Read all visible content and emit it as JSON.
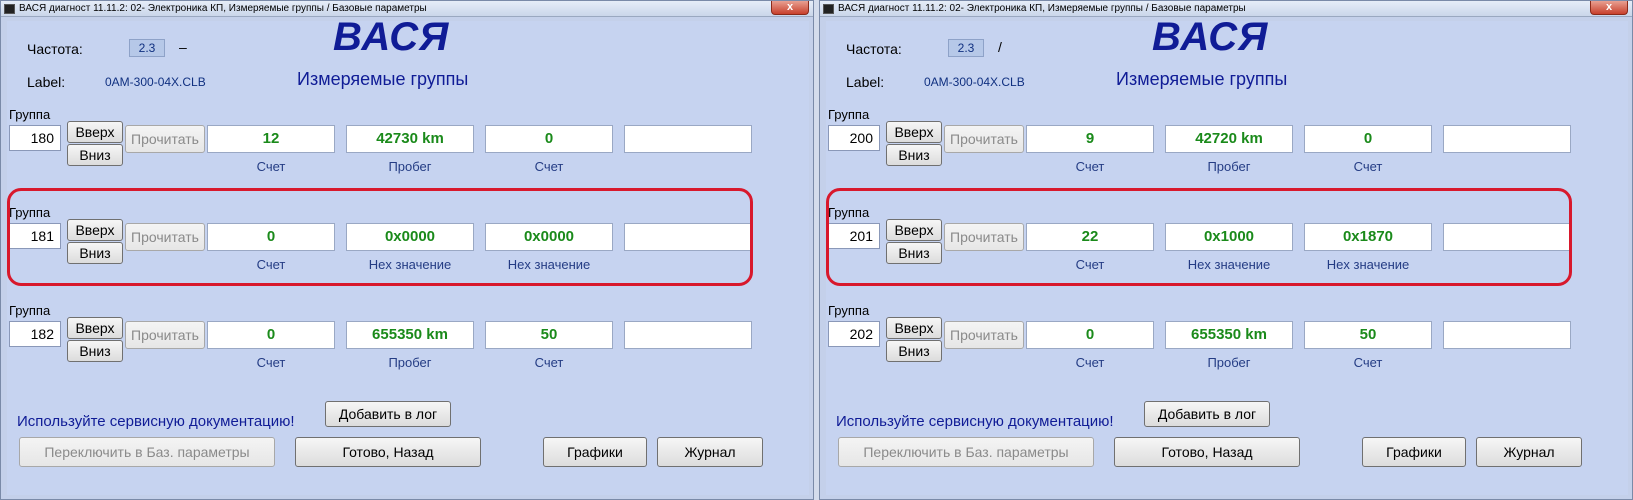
{
  "windows": [
    {
      "title": "ВАСЯ диагност 11.11.2: 02- Электроника КП,  Измеряемые группы / Базовые параметры",
      "close": "x",
      "freq_label": "Частота:",
      "freq_value": "2.3",
      "freq_indicator": "–",
      "brand": "ВАСЯ",
      "subtitle": "Измеряемые группы",
      "label_label": "Label:",
      "label_value": "0AM-300-04X.CLB",
      "groups": [
        {
          "group_label": "Группа",
          "number": "180",
          "up": "Вверх",
          "down": "Вниз",
          "read": "Прочитать",
          "values": [
            "12",
            "42730 km",
            "0",
            ""
          ],
          "units": [
            "Счет",
            "Пробег",
            "Счет",
            ""
          ]
        },
        {
          "group_label": "Группа",
          "number": "181",
          "up": "Вверх",
          "down": "Вниз",
          "read": "Прочитать",
          "values": [
            "0",
            "0x0000",
            "0x0000",
            ""
          ],
          "units": [
            "Счет",
            "Hex значение",
            "Hex значение",
            ""
          ]
        },
        {
          "group_label": "Группа",
          "number": "182",
          "up": "Вверх",
          "down": "Вниз",
          "read": "Прочитать",
          "values": [
            "0",
            "655350 km",
            "50",
            ""
          ],
          "units": [
            "Счет",
            "Пробег",
            "Счет",
            ""
          ]
        }
      ],
      "warning": "Используйте сервисную документацию!",
      "add_log": "Добавить в лог",
      "switch_basic": "Переключить в Баз. параметры",
      "done_back": "Готово, Назад",
      "graphs": "Графики",
      "journal": "Журнал"
    },
    {
      "title": "ВАСЯ диагност 11.11.2: 02- Электроника КП,  Измеряемые группы / Базовые параметры",
      "close": "x",
      "freq_label": "Частота:",
      "freq_value": "2.3",
      "freq_indicator": "/",
      "brand": "ВАСЯ",
      "subtitle": "Измеряемые группы",
      "label_label": "Label:",
      "label_value": "0AM-300-04X.CLB",
      "groups": [
        {
          "group_label": "Группа",
          "number": "200",
          "up": "Вверх",
          "down": "Вниз",
          "read": "Прочитать",
          "values": [
            "9",
            "42720 km",
            "0",
            ""
          ],
          "units": [
            "Счет",
            "Пробег",
            "Счет",
            ""
          ]
        },
        {
          "group_label": "Группа",
          "number": "201",
          "up": "Вверх",
          "down": "Вниз",
          "read": "Прочитать",
          "values": [
            "22",
            "0x1000",
            "0x1870",
            ""
          ],
          "units": [
            "Счет",
            "Hex значение",
            "Hex значение",
            ""
          ]
        },
        {
          "group_label": "Группа",
          "number": "202",
          "up": "Вверх",
          "down": "Вниз",
          "read": "Прочитать",
          "values": [
            "0",
            "655350 km",
            "50",
            ""
          ],
          "units": [
            "Счет",
            "Пробег",
            "Счет",
            ""
          ]
        }
      ],
      "warning": "Используйте сервисную документацию!",
      "add_log": "Добавить в лог",
      "switch_basic": "Переключить в Баз. параметры",
      "done_back": "Готово, Назад",
      "graphs": "Графики",
      "journal": "Журнал"
    }
  ],
  "colors": {
    "value_text": "#1a8a1a",
    "brand": "#101c96",
    "highlight": "#d8182c"
  }
}
